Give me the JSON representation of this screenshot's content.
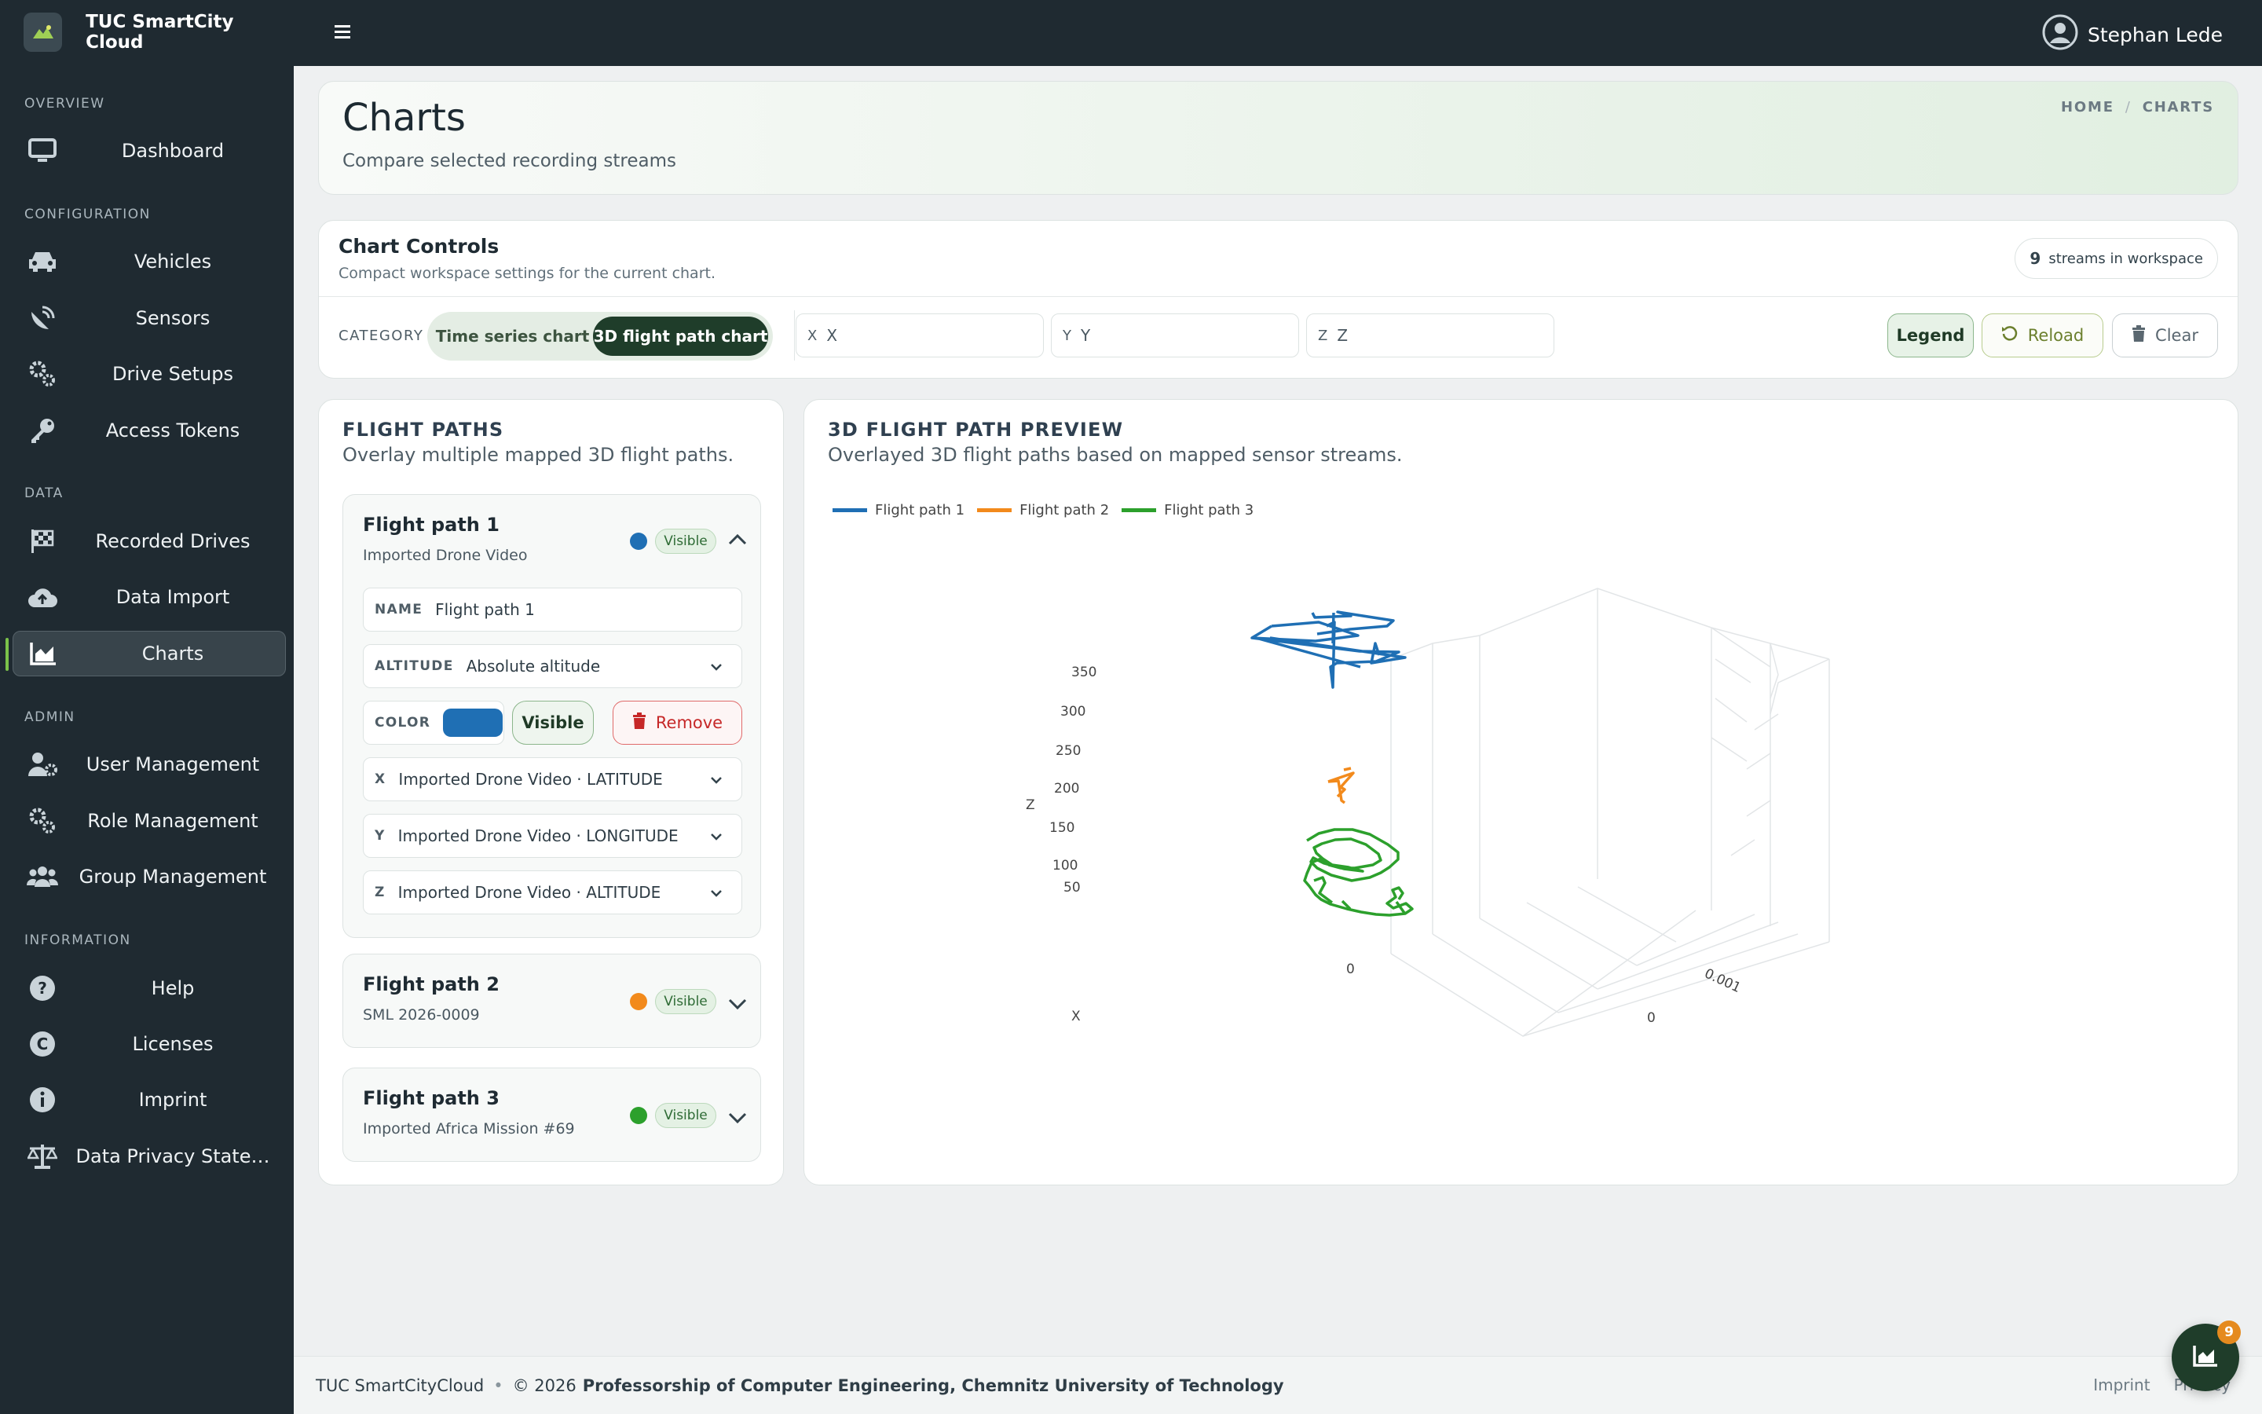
{
  "app": {
    "title": "TUC SmartCity Cloud"
  },
  "sidebar": {
    "sections": [
      {
        "label": "OVERVIEW",
        "items": [
          {
            "label": "Dashboard",
            "icon": "monitor-icon"
          }
        ]
      },
      {
        "label": "CONFIGURATION",
        "items": [
          {
            "label": "Vehicles",
            "icon": "car-icon"
          },
          {
            "label": "Sensors",
            "icon": "satellite-dish-icon"
          },
          {
            "label": "Drive Setups",
            "icon": "gears-icon"
          },
          {
            "label": "Access Tokens",
            "icon": "key-icon"
          }
        ]
      },
      {
        "label": "DATA",
        "items": [
          {
            "label": "Recorded Drives",
            "icon": "checkered-flag-icon"
          },
          {
            "label": "Data Import",
            "icon": "cloud-upload-icon"
          },
          {
            "label": "Charts",
            "icon": "area-chart-icon",
            "active": true
          }
        ]
      },
      {
        "label": "ADMIN",
        "items": [
          {
            "label": "User Management",
            "icon": "user-gear-icon"
          },
          {
            "label": "Role Management",
            "icon": "gears-icon"
          },
          {
            "label": "Group Management",
            "icon": "users-icon"
          }
        ]
      },
      {
        "label": "INFORMATION",
        "items": [
          {
            "label": "Help",
            "icon": "question-circle-icon"
          },
          {
            "label": "Licenses",
            "icon": "copyright-icon"
          },
          {
            "label": "Imprint",
            "icon": "info-circle-icon"
          },
          {
            "label": "Data Privacy State…",
            "icon": "scale-icon"
          }
        ]
      }
    ]
  },
  "topbar": {
    "user_name": "Stephan Lede"
  },
  "header": {
    "title": "Charts",
    "subtitle": "Compare selected recording streams",
    "breadcrumb": [
      "HOME",
      "CHARTS"
    ]
  },
  "controls": {
    "title": "Chart Controls",
    "subtitle": "Compact workspace settings for the current chart.",
    "streams_count": "9",
    "streams_label": "streams in workspace",
    "category_label": "CATEGORY",
    "categories": [
      "Time series chart",
      "3D flight path chart"
    ],
    "selected_category": "3D flight path chart",
    "axes": [
      {
        "key": "X",
        "value": "X"
      },
      {
        "key": "Y",
        "value": "Y"
      },
      {
        "key": "Z",
        "value": "Z"
      }
    ],
    "legend_label": "Legend",
    "reload_label": "Reload",
    "clear_label": "Clear"
  },
  "flight_paths": {
    "title": "FLIGHT PATHS",
    "subtitle": "Overlay multiple mapped 3D flight paths.",
    "visible_label": "Visible",
    "items": [
      {
        "name": "Flight path 1",
        "source": "Imported Drone Video",
        "color": "#1f6fb4",
        "expanded": true,
        "fields": {
          "name_label": "NAME",
          "name_value": "Flight path 1",
          "altitude_label": "ALTITUDE",
          "altitude_value": "Absolute altitude",
          "color_label": "COLOR",
          "visible_button": "Visible",
          "remove_button": "Remove",
          "x_key": "X",
          "x_value": "Imported Drone Video · LATITUDE",
          "y_key": "Y",
          "y_value": "Imported Drone Video · LONGITUDE",
          "z_key": "Z",
          "z_value": "Imported Drone Video · ALTITUDE"
        }
      },
      {
        "name": "Flight path 2",
        "source": "SML 2026-0009",
        "color": "#f28a1c",
        "expanded": false
      },
      {
        "name": "Flight path 3",
        "source": "Imported Africa Mission #69",
        "color": "#2ca02c",
        "expanded": false
      }
    ]
  },
  "preview": {
    "title": "3D FLIGHT PATH PREVIEW",
    "subtitle": "Overlayed 3D flight paths based on mapped sensor streams.",
    "legend": [
      {
        "name": "Flight path 1",
        "color": "#1f6fb4"
      },
      {
        "name": "Flight path 2",
        "color": "#f28a1c"
      },
      {
        "name": "Flight path 3",
        "color": "#2ca02c"
      }
    ],
    "axis_labels": {
      "x": "X",
      "y": "",
      "z": "Z"
    },
    "z_ticks": [
      "50",
      "100",
      "150",
      "200",
      "250",
      "300",
      "350"
    ],
    "x_ticks": [
      "0"
    ],
    "y_ticks": [
      "0.001",
      "0"
    ]
  },
  "footer": {
    "brand": "TUC SmartCityCloud",
    "sep": "•",
    "copyright": "© 2026",
    "org": "Professorship of Computer Engineering, Chemnitz University of Technology",
    "links": [
      "Imprint",
      "Privacy"
    ]
  },
  "fab": {
    "badge": "9",
    "icon": "area-chart-icon"
  },
  "colors": {
    "accent": "#1f3d2a",
    "sidebar_bg": "#1f2a31",
    "active_bar": "#7bc24a"
  }
}
